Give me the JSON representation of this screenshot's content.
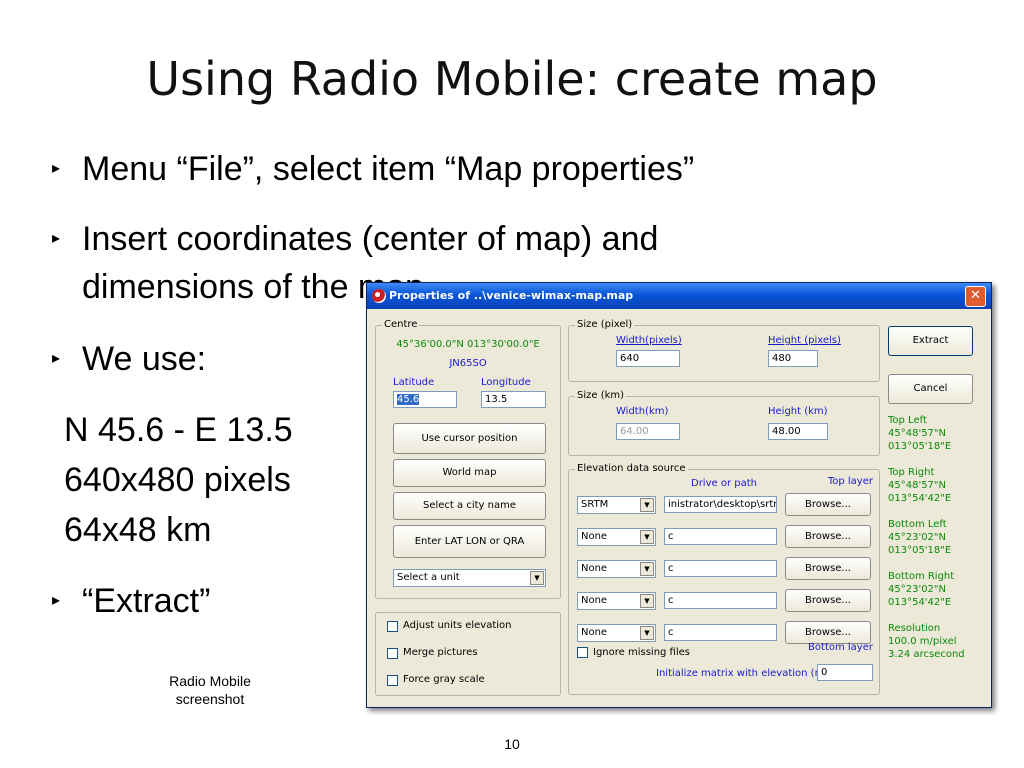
{
  "slide": {
    "title": "Using Radio Mobile: create map",
    "bullets": [
      "Menu “File”, select item “Map properties”",
      "Insert coordinates (center of map) and",
      "dimensions of the map",
      "We use:",
      "“Extract”"
    ],
    "values": [
      "N 45.6 - E 13.5",
      "640x480 pixels",
      "64x48 km"
    ],
    "caption": [
      "Radio Mobile",
      "screenshot"
    ],
    "page_number": "10"
  },
  "dialog": {
    "title": "Properties of ..\\venice-wimax-map.map",
    "close": "✕",
    "centre": {
      "legend": "Centre",
      "coords": "45°36'00.0\"N 013°30'00.0\"E",
      "qra": "JN65SO",
      "latitude_label": "Latitude",
      "longitude_label": "Longitude",
      "latitude_value": "45.6",
      "longitude_value": "13.5",
      "buttons": [
        "Use cursor position",
        "World map",
        "Select a city name",
        "Enter LAT LON or QRA"
      ],
      "unit_select": "Select a unit"
    },
    "options": [
      "Adjust units elevation",
      "Merge pictures",
      "Force gray scale"
    ],
    "size_pixel": {
      "legend": "Size (pixel)",
      "width_label": "Width(pixels)",
      "height_label": "Height (pixels)",
      "width_value": "640",
      "height_value": "480"
    },
    "size_km": {
      "legend": "Size (km)",
      "width_label": "Width(km)",
      "height_label": "Height (km)",
      "width_value": "64.00",
      "height_value": "48.00"
    },
    "elevation": {
      "legend": "Elevation data source",
      "drive_label": "Drive or path",
      "top_layer": "Top layer",
      "bottom_layer": "Bottom layer",
      "rows": [
        {
          "source": "SRTM",
          "path": "inistrator\\desktop\\srtm",
          "browse": "Browse..."
        },
        {
          "source": "None",
          "path": "c",
          "browse": "Browse..."
        },
        {
          "source": "None",
          "path": "c",
          "browse": "Browse..."
        },
        {
          "source": "None",
          "path": "c",
          "browse": "Browse..."
        },
        {
          "source": "None",
          "path": "c",
          "browse": "Browse..."
        }
      ],
      "ignore_missing": "Ignore missing files",
      "init_label": "Initialize matrix with elevation (m)",
      "init_value": "0"
    },
    "extract": "Extract",
    "cancel": "Cancel",
    "corners": {
      "top_left": [
        "Top Left",
        "45°48'57\"N",
        "013°05'18\"E"
      ],
      "top_right": [
        "Top Right",
        "45°48'57\"N",
        "013°54'42\"E"
      ],
      "bottom_left": [
        "Bottom Left",
        "45°23'02\"N",
        "013°05'18\"E"
      ],
      "bottom_right": [
        "Bottom Right",
        "45°23'02\"N",
        "013°54'42\"E"
      ],
      "resolution": [
        "Resolution",
        "100.0 m/pixel",
        "3.24 arcsecond"
      ]
    }
  }
}
